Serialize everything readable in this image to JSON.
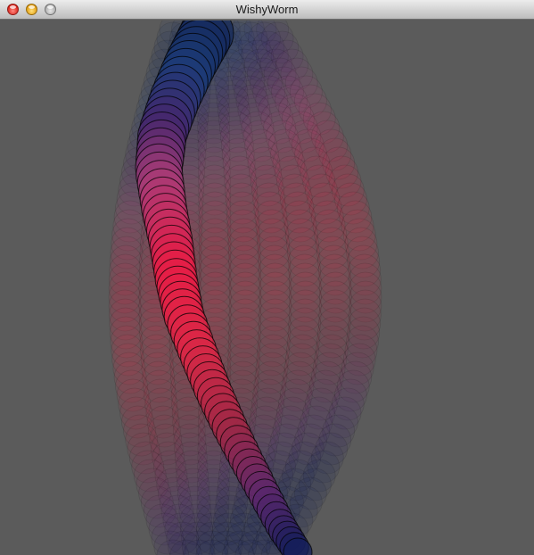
{
  "window": {
    "title": "WishyWorm"
  },
  "colors": {
    "canvas_background": "#5b5b5b",
    "titlebar_top": "#ececec",
    "titlebar_bottom": "#bdbdbd",
    "close_button": "#d91e17",
    "minimize_button": "#e19a0b",
    "zoom_button": "#a9a9a9"
  },
  "icons": [
    "close-icon",
    "minimize-icon",
    "zoom-icon"
  ]
}
